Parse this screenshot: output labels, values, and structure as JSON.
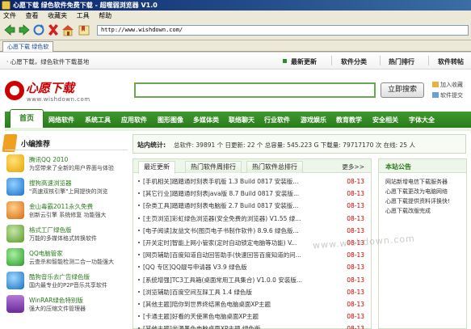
{
  "window": {
    "title": "心愿下载 绿色软件免费下载 - 超噬弱浏览器 V1.0"
  },
  "menu": [
    "文件",
    "查看",
    "收藏夹",
    "工具",
    "帮助"
  ],
  "toolbar": {
    "address": "http://www.wishdown.com/"
  },
  "tab": {
    "label": "心愿下载 绿色软"
  },
  "topnav": {
    "welcome": "· 心愿下载，绿色软件下载基地",
    "items": [
      "最新更新",
      "软件分类",
      "热门排行",
      "软件转帖"
    ]
  },
  "logo": {
    "name": "心愿下载",
    "url": "www.wishdown.com"
  },
  "search": {
    "value": "",
    "button": "立即搜索"
  },
  "quick": {
    "favorite": "加入收藏",
    "submit": "软件提交"
  },
  "mainnav": {
    "home": "首页",
    "items": [
      "网络软件",
      "系统工具",
      "应用软件",
      "图形图像",
      "多媒体类",
      "联络聊天",
      "行业软件",
      "游戏娱乐",
      "教育教学",
      "安全相关",
      "字体大全"
    ]
  },
  "left": {
    "heading": "小编推荐",
    "items": [
      {
        "title": "腾讯QQ 2010",
        "desc": "为您带来了全新的用户界面与体验"
      },
      {
        "title": "搜狗高速浏览器",
        "desc": "\"高速双核引擎\"上网提快的浏览"
      },
      {
        "title": "金山毒霸2011永久免费",
        "desc": "创新云引擎 系统修复 功能强大"
      },
      {
        "title": "格式工厂绿色版",
        "desc": "万能的多媒体格式转换软件"
      },
      {
        "title": "QQ电脑管家",
        "desc": "云查杀和智能检测二合一功能强大"
      },
      {
        "title": "酷狗音乐去广告绿色版",
        "desc": "国内最专业的P2P音乐共享软件"
      },
      {
        "title": "WinRAR绿色特别版",
        "desc": "强大的压缩文件管理器"
      }
    ]
  },
  "stats": {
    "label": "站内统计:",
    "text": "总软件: 39891 个 日更新: 22 个 总容量: 545.223 G 下载量: 79717170 次 在线: 25 人"
  },
  "list": {
    "tabs": [
      "最近更新",
      "热门软件周排行",
      "热门软件总排行"
    ],
    "more": "更多>>",
    "rows": [
      {
        "title": "[手机相关]踏踏通时刻表手机版 1.3 Build 0817 安装版...",
        "date": "08-13"
      },
      {
        "title": "[其它行业]踏踏通时刻表java版 8.7 Build 0817 安装版...",
        "date": "08-13"
      },
      {
        "title": "[杂类工具]踏踏通时刻表电脑版 2.7 Build 0817 安装版...",
        "date": "08-13"
      },
      {
        "title": "[主页浏览]彩虹绿色浏览器(安全免费的浏览器) V1.55 绿...",
        "date": "08-13"
      },
      {
        "title": "[电子阅读]友益文书(图页电子书制作软件) 8.9.6 绿色版...",
        "date": "08-13"
      },
      {
        "title": "[开关定时]智能上网小管家(定时自动锁定电脑等功能) V...",
        "date": "08-13"
      },
      {
        "title": "[网页辅助]百度知道自动回答助手(快速回答百度知道的问...",
        "date": "08-13"
      },
      {
        "title": "[QQ 专区]QQ靓号申请器 V3.9 绿色版",
        "date": "08-13"
      },
      {
        "title": "[系统增强]TC3工具箱(桌面常用工具集合) V1.0.0 安装版...",
        "date": "08-13"
      },
      {
        "title": "[浏览辅助]百度空间互踩工具 1.4 绿色版",
        "date": "08-13"
      },
      {
        "title": "[其他主题]陪你到世界终结黑色电脑桌面XP主题",
        "date": "08-13"
      },
      {
        "title": "[卡通主题]好看的天使黑色电脑桌面XP主题",
        "date": "08-13"
      },
      {
        "title": "[其他主题]光源黑色电脑桌面XP主题 绿色版",
        "date": "08-13"
      }
    ]
  },
  "notice": {
    "title": "本站公告",
    "items": [
      "网站新增电信下载服务器",
      "心愿下载更改为电脑网络",
      "心愿下载提供资料评换快!",
      "心愿下载改版完成"
    ]
  },
  "watermark": "www.wishdown.com",
  "colors": {
    "brand_green": "#2a7a1c",
    "brand_red": "#cc0000",
    "date_red": "#cc0000"
  }
}
